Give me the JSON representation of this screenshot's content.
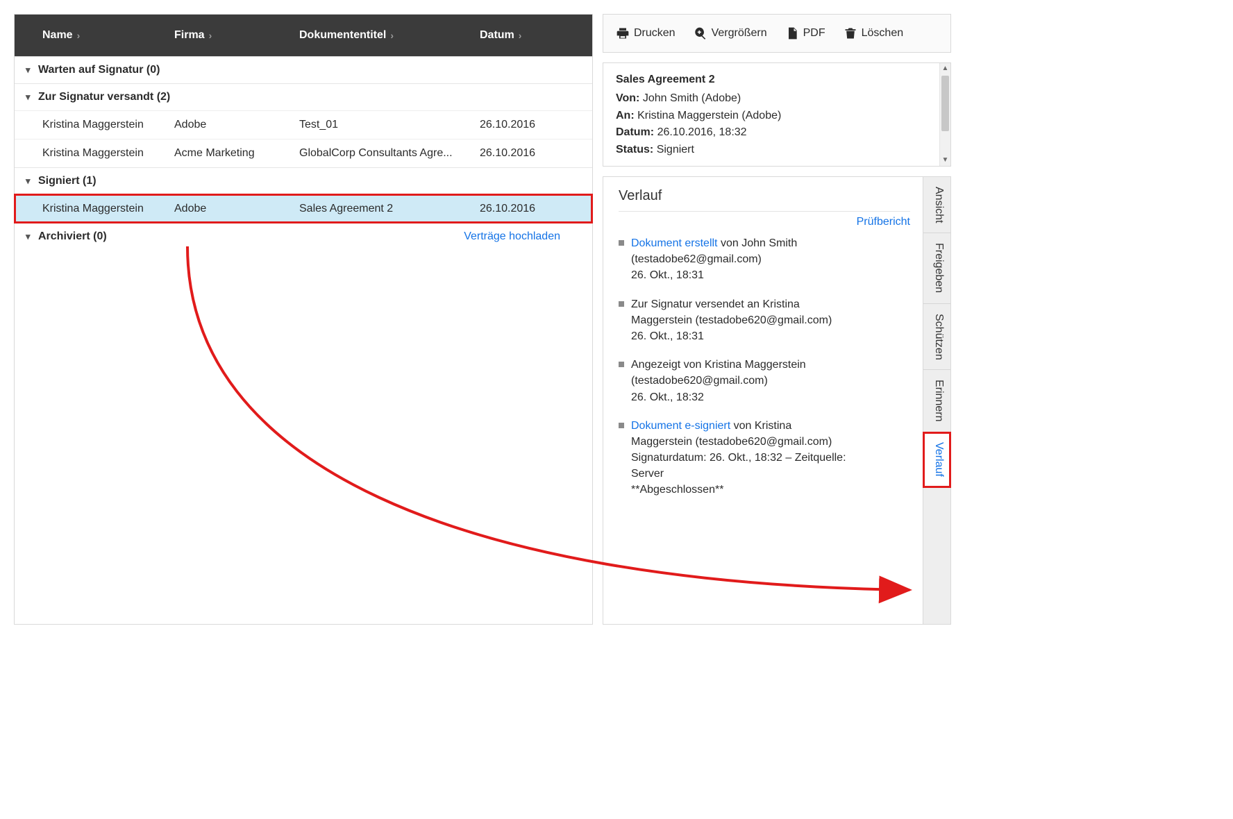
{
  "columns": {
    "name": "Name",
    "firma": "Firma",
    "doc": "Dokumententitel",
    "date": "Datum"
  },
  "groups": [
    {
      "id": "waiting",
      "label": "Warten auf Signatur (0)",
      "rows": []
    },
    {
      "id": "sent",
      "label": "Zur Signatur versandt (2)",
      "rows": [
        {
          "name": "Kristina Maggerstein",
          "firma": "Adobe",
          "doc": "Test_01",
          "date": "26.10.2016"
        },
        {
          "name": "Kristina Maggerstein",
          "firma": "Acme Marketing",
          "doc": "GlobalCorp Consultants Agre...",
          "date": "26.10.2016"
        }
      ]
    },
    {
      "id": "signed",
      "label": "Signiert (1)",
      "rows": [
        {
          "name": "Kristina Maggerstein",
          "firma": "Adobe",
          "doc": "Sales Agreement 2",
          "date": "26.10.2016",
          "selected": true
        }
      ]
    },
    {
      "id": "archived",
      "label": "Archiviert (0)",
      "rows": [],
      "link": "Verträge hochladen"
    }
  ],
  "toolbar": {
    "print": "Drucken",
    "zoom": "Vergrößern",
    "pdf": "PDF",
    "delete": "Löschen"
  },
  "details": {
    "title": "Sales Agreement 2",
    "from_label": "Von:",
    "from": "John Smith (Adobe)",
    "to_label": "An:",
    "to": "Kristina Maggerstein (Adobe)",
    "date_label": "Datum:",
    "date": "26.10.2016, 18:32",
    "status_label": "Status:",
    "status": "Signiert"
  },
  "history": {
    "heading": "Verlauf",
    "audit": "Prüfbericht",
    "items": [
      {
        "link": "Dokument erstellt",
        "rest": " von John Smith (testadobe62@gmail.com)",
        "ts": "26. Okt., 18:31"
      },
      {
        "link": "",
        "rest": "Zur Signatur versendet an Kristina Maggerstein (testadobe620@gmail.com)",
        "ts": "26. Okt., 18:31"
      },
      {
        "link": "",
        "rest": "Angezeigt von Kristina Maggerstein (testadobe620@gmail.com)",
        "ts": "26. Okt., 18:32"
      },
      {
        "link": "Dokument e-signiert",
        "rest": " von Kristina Maggerstein (testadobe620@gmail.com)",
        "ts": "Signaturdatum: 26. Okt., 18:32 – Zeitquelle: Server",
        "extra": "**Abgeschlossen**"
      }
    ]
  },
  "sidetabs": {
    "view": "Ansicht",
    "share": "Freigeben",
    "protect": "Schützen",
    "remind": "Erinnern",
    "history": "Verlauf"
  }
}
